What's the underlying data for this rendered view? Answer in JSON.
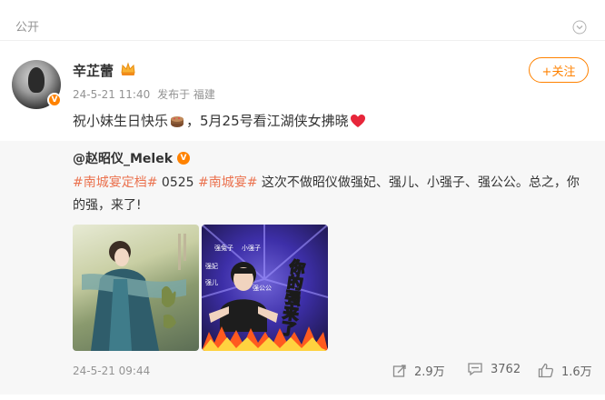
{
  "header": {
    "visibility": "公开",
    "chevron_icon": "chevron-down-icon"
  },
  "post": {
    "author_name": "辛芷蕾",
    "time": "24-5-21 11:40",
    "published_from": "发布于 福建",
    "follow_label": "+关注",
    "text_part1": "祝小妹生日快乐",
    "text_part2": "，5月25号看江湖侠女拂晓",
    "emoji1": "cake-icon",
    "emoji2": "heart-icon"
  },
  "repost": {
    "author": "@赵昭仪_Melek",
    "tag1": "#南城宴定档#",
    "mid_text": " 0525 ",
    "tag2": "#南城宴#",
    "rest_text": " 这次不做昭仪做强妃、强儿、小强子、强公公。总之，你的强，来了!",
    "images": [
      {
        "alt": "poster-image"
      },
      {
        "alt": "meme-image",
        "caption": "你的强来了",
        "labels": [
          "强兔子",
          "强妃",
          "强儿",
          "小强子",
          "强公公"
        ]
      }
    ],
    "time": "24-5-21 09:44",
    "stats": {
      "reposts": "2.9万",
      "comments": "3762",
      "likes": "1.6万"
    }
  },
  "colors": {
    "accent": "#ff8200",
    "tag": "#eb7350"
  }
}
